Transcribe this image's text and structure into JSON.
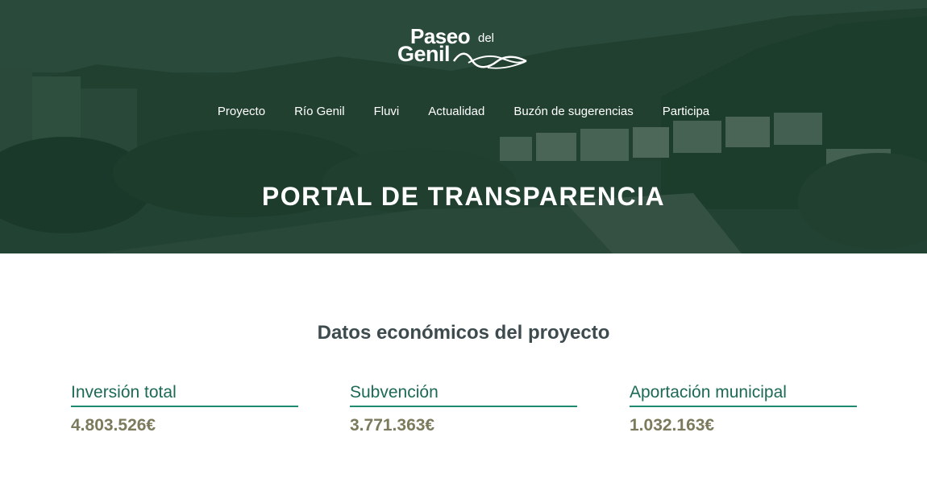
{
  "logo": {
    "line1": "Paseo",
    "line1_small": "del",
    "line2": "Genil"
  },
  "nav": {
    "items": [
      {
        "label": "Proyecto"
      },
      {
        "label": "Río Genil"
      },
      {
        "label": "Fluvi"
      },
      {
        "label": "Actualidad"
      },
      {
        "label": "Buzón de sugerencias"
      },
      {
        "label": "Participa"
      }
    ]
  },
  "hero": {
    "title": "PORTAL DE TRANSPARENCIA"
  },
  "section": {
    "title": "Datos económicos del proyecto"
  },
  "stats": [
    {
      "label": "Inversión total",
      "value": "4.803.526€"
    },
    {
      "label": "Subvención",
      "value": "3.771.363€"
    },
    {
      "label": "Aportación municipal",
      "value": "1.032.163€"
    }
  ],
  "colors": {
    "accent": "#1f8a70",
    "label": "#1c6a55",
    "value": "#7c7a5c",
    "hero_tint": "#163a2a"
  }
}
